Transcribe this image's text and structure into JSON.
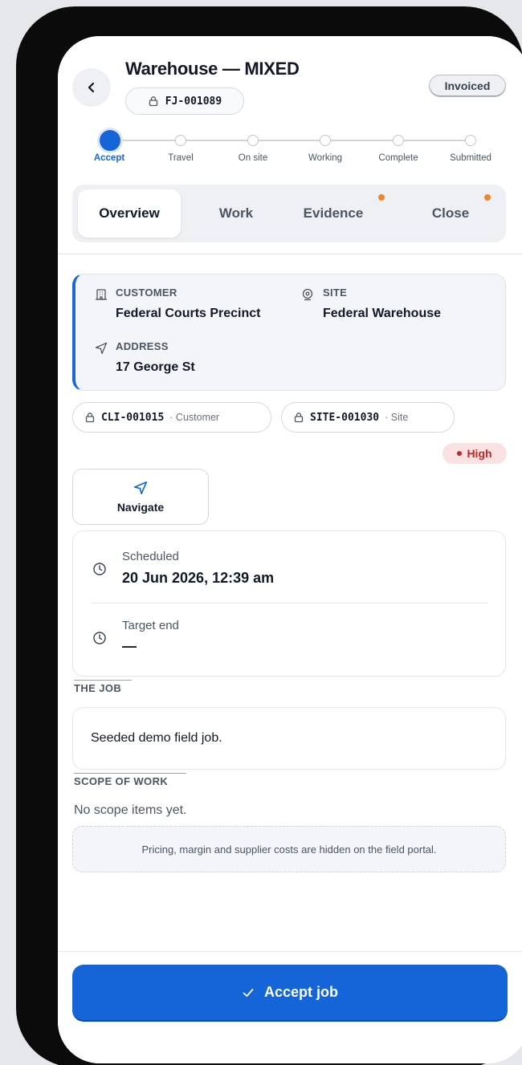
{
  "header": {
    "title": "Warehouse — MIXED",
    "job_id": "FJ-001089",
    "status": "Invoiced"
  },
  "stepper": {
    "steps": [
      "Accept",
      "Travel",
      "On site",
      "Working",
      "Complete",
      "Submitted"
    ],
    "active_index": 0
  },
  "tabs": [
    {
      "label": "Overview",
      "active": true,
      "alert": false
    },
    {
      "label": "Work",
      "active": false,
      "alert": false
    },
    {
      "label": "Evidence",
      "active": false,
      "alert": true
    },
    {
      "label": "Close",
      "active": false,
      "alert": true
    }
  ],
  "info": {
    "customer_label": "CUSTOMER",
    "customer_value": "Federal Courts Precinct",
    "site_label": "SITE",
    "site_value": "Federal Warehouse",
    "address_label": "ADDRESS",
    "address_value": "17 George St"
  },
  "refs": [
    {
      "code": "CLI-001015",
      "kind": "· Customer"
    },
    {
      "code": "SITE-001030",
      "kind": "· Site"
    }
  ],
  "priority": "High",
  "navigate_label": "Navigate",
  "schedule": {
    "scheduled_label": "Scheduled",
    "scheduled_value": "20 Jun 2026, 12:39 am",
    "target_label": "Target end",
    "target_value": "—"
  },
  "job_section": {
    "heading": "THE JOB",
    "description": "Seeded demo field job."
  },
  "scope_section": {
    "heading": "SCOPE OF WORK",
    "empty_text": "No scope items yet.",
    "notice": "Pricing, margin and supplier costs are hidden on the field portal."
  },
  "footer": {
    "accept_label": "Accept job"
  },
  "colors": {
    "primary": "#1565d8",
    "alert_dot": "#f0862a",
    "priority_high": "#c0282a",
    "priority_high_bg": "#fbe2e2"
  },
  "icons": [
    "chevron-left-icon",
    "lock-icon",
    "building-icon",
    "location-pin-icon",
    "navigation-arrow-icon",
    "clock-icon",
    "check-icon"
  ]
}
